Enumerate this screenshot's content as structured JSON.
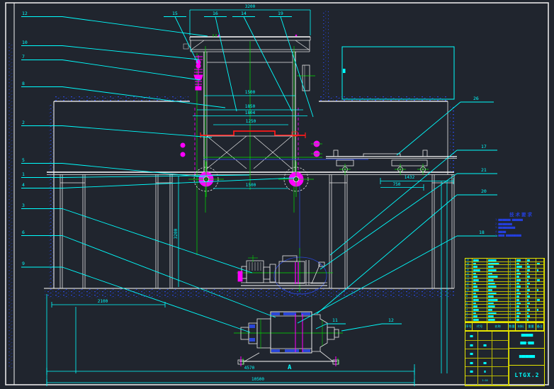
{
  "colors": {
    "background": "#20252e",
    "cyan": "#00ffff",
    "white": "#f2f2f2",
    "green": "#00e000",
    "magenta": "#ff00ff",
    "red": "#ff1a1a",
    "yellow": "#e6e600",
    "blue": "#2a46d8"
  },
  "balloons": {
    "left": [
      "12",
      "10",
      "7",
      "8",
      "2",
      "5",
      "1",
      "4",
      "3",
      "6",
      "9"
    ],
    "top": [
      "15",
      "16",
      "14",
      "19"
    ],
    "right": [
      "26",
      "17",
      "21",
      "20",
      "18"
    ],
    "bottom": [
      "11",
      "12"
    ]
  },
  "dims": {
    "overall_width": "3200",
    "frame_w1": "1500",
    "frame_w2": "1850",
    "frame_w3": "1804",
    "rail_span": "1250",
    "lower_span": "1500",
    "trolley_span": "1432",
    "wheel_base": "750",
    "pit_width": "2100",
    "column_height": "3200",
    "base_width": "4570",
    "overall_length": "10500"
  },
  "view_labels": {
    "section": "A"
  },
  "notes": {
    "title": "技术要求",
    "lines": [
      "1.▆▆▆▆▆▆▆▆ ▆▆▆▆▆▆▆",
      "2.▆▆▆▆▆▆▆▆▆",
      "3.▆▆▆▆▆▆▆▆▆▆▆",
      "4.▆▆▆▆▆",
      "5.▆▆▆▆ ▆▆▆▆▆▆▆▆▆▆"
    ]
  },
  "parts_table": {
    "columns": [
      "序号",
      "代号",
      "名称",
      "数量",
      "材料",
      "重量",
      "备注"
    ],
    "rows": [
      [
        "19",
        "▆▆▆▆",
        "▆▆▆▆▆▆",
        "1",
        "▆▆▆",
        "▆▆",
        ""
      ],
      [
        "18",
        "▆▆",
        "▆▆▆▆▆▆▆▆",
        "2",
        "▆▆",
        "▆",
        "▆▆"
      ],
      [
        "17",
        "▆▆▆",
        "▆▆▆▆",
        "1",
        "▆▆▆▆",
        "▆▆",
        ""
      ],
      [
        "16",
        "▆▆▆▆▆",
        "▆▆▆▆▆▆",
        "4",
        "▆▆",
        "▆▆",
        "▆"
      ],
      [
        "15",
        "▆▆",
        "▆▆▆",
        "2",
        "▆▆▆",
        "▆",
        ""
      ],
      [
        "14",
        "▆▆▆",
        "▆▆▆▆▆▆▆",
        "1",
        "▆▆",
        "▆▆",
        ""
      ],
      [
        "13",
        "▆▆▆▆",
        "▆▆▆▆",
        "2",
        "▆▆▆",
        "▆",
        "▆▆"
      ],
      [
        "12",
        "▆▆",
        "▆▆▆▆▆",
        "1",
        "▆▆",
        "▆▆",
        ""
      ],
      [
        "11",
        "▆▆▆",
        "▆▆▆▆▆▆",
        "6",
        "▆▆▆",
        "▆",
        ""
      ],
      [
        "10",
        "▆▆▆▆",
        "▆▆▆",
        "1",
        "▆▆",
        "▆▆",
        "▆"
      ],
      [
        "9",
        "▆▆",
        "▆▆▆▆▆▆",
        "2",
        "▆▆▆",
        "▆",
        ""
      ],
      [
        "8",
        "▆▆▆",
        "▆▆▆▆",
        "1",
        "▆▆",
        "▆▆",
        ""
      ],
      [
        "7",
        "▆▆▆▆",
        "▆▆▆▆▆▆▆",
        "2",
        "▆▆",
        "▆",
        "▆▆"
      ],
      [
        "6",
        "▆▆",
        "▆▆▆▆",
        "1",
        "▆▆▆",
        "▆▆",
        ""
      ],
      [
        "5",
        "▆▆▆",
        "▆▆▆▆▆",
        "4",
        "▆▆",
        "▆",
        ""
      ],
      [
        "4",
        "▆▆▆▆",
        "▆▆▆",
        "1",
        "▆▆",
        "▆▆",
        "▆"
      ],
      [
        "3",
        "▆▆",
        "▆▆▆▆▆▆",
        "2",
        "▆▆▆",
        "▆",
        ""
      ],
      [
        "2",
        "▆▆▆",
        "▆▆▆▆",
        "1",
        "▆▆",
        "▆▆",
        ""
      ],
      [
        "1",
        "▆▆▆▆",
        "▆▆▆▆▆",
        "1",
        "▆▆",
        "▆",
        ""
      ]
    ]
  },
  "title_block": {
    "cells": [
      "▆▆",
      "",
      "",
      "▆▆",
      "▆▆",
      "",
      "▆▆",
      "",
      "",
      "▆▆",
      "▆▆",
      "",
      "▆▆",
      "▆",
      "",
      "",
      "1:10",
      ""
    ],
    "product_line1": "▆▆▆▆▆▆",
    "product_line2": "▆▆▆—▆▆▆",
    "sub_title": "▆▆▆▆▆▆▆▆",
    "drawing_no": "LTGX.2"
  }
}
